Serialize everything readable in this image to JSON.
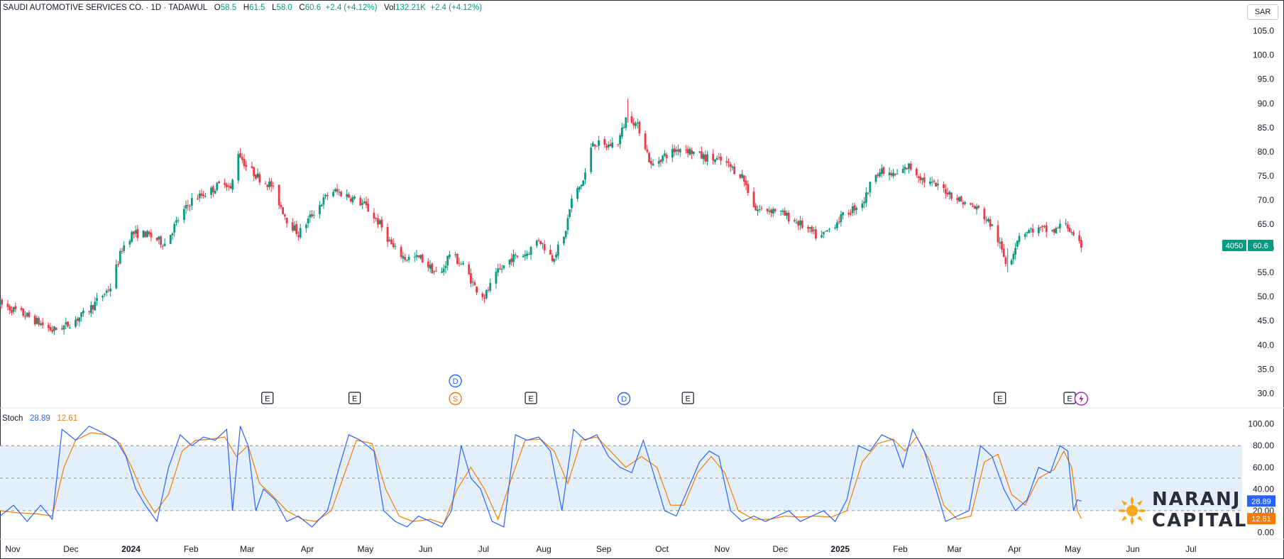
{
  "header": {
    "symbol": "SAUDI AUTOMOTIVE SERVICES CO. · 1D · TADAWUL",
    "o_label": "O",
    "o_value": "58.5",
    "h_label": "H",
    "h_value": "61.5",
    "l_label": "L",
    "l_value": "58.0",
    "c_label": "C",
    "c_value": "60.6",
    "change": "+2.4 (+4.12%)",
    "vol_label": "Vol",
    "vol_value": "132.21K",
    "vol_change": "+2.4 (+4.12%)"
  },
  "currency": "SAR",
  "price_tag": {
    "ticker": "4050",
    "price": "60.6"
  },
  "stoch": {
    "label": "Stoch",
    "k_value": "28.89",
    "d_value": "12.61"
  },
  "logo": {
    "line1": "NARANJ",
    "line2": "CAPITAL"
  },
  "colors": {
    "up": "#089981",
    "down": "#f23645",
    "k": "#2962ff",
    "d": "#f57c00",
    "band": "#e3f0fb"
  },
  "events": [
    {
      "type": "E",
      "date": "2024-03-18"
    },
    {
      "type": "E",
      "date": "2024-05-02"
    },
    {
      "type": "D",
      "date": "2024-06-23"
    },
    {
      "type": "S",
      "date": "2024-06-23"
    },
    {
      "type": "E",
      "date": "2024-08-01"
    },
    {
      "type": "D",
      "date": "2024-09-18"
    },
    {
      "type": "E",
      "date": "2024-10-21"
    },
    {
      "type": "E",
      "date": "2025-03-31"
    },
    {
      "type": "E",
      "date": "2025-05-06"
    },
    {
      "type": "flash",
      "date": "2025-05-12"
    }
  ],
  "chart_data": {
    "type": "candlestick",
    "x_axis": {
      "tick_labels": [
        "Nov",
        "Dec",
        "2024",
        "Feb",
        "Mar",
        "Apr",
        "May",
        "Jun",
        "Jul",
        "Aug",
        "Sep",
        "Oct",
        "Nov",
        "Dec",
        "2025",
        "Feb",
        "Mar",
        "Apr",
        "May",
        "Jun",
        "Jul"
      ],
      "range": [
        "2023-11-01",
        "2025-08-03"
      ]
    },
    "price_axis": {
      "ticks": [
        "105.0",
        "100.0",
        "95.0",
        "90.0",
        "85.0",
        "80.0",
        "75.0",
        "70.0",
        "65.0",
        "60.0",
        "55.0",
        "50.0",
        "45.0",
        "40.0",
        "35.0",
        "30.0"
      ],
      "range": [
        28,
        107
      ],
      "scale": "linear"
    },
    "price_series": [
      [
        "2023-11-01",
        48.5
      ],
      [
        "2023-11-15",
        46
      ],
      [
        "2023-11-28",
        43
      ],
      [
        "2023-12-05",
        44
      ],
      [
        "2023-12-15",
        46.5
      ],
      [
        "2023-12-28",
        52
      ],
      [
        "2024-01-03",
        60
      ],
      [
        "2024-01-08",
        63
      ],
      [
        "2024-01-15",
        63
      ],
      [
        "2024-01-25",
        61
      ],
      [
        "2024-02-01",
        66
      ],
      [
        "2024-02-08",
        70
      ],
      [
        "2024-02-18",
        72
      ],
      [
        "2024-02-25",
        74
      ],
      [
        "2024-02-28",
        72
      ],
      [
        "2024-03-03",
        80
      ],
      [
        "2024-03-07",
        77
      ],
      [
        "2024-03-14",
        74.5
      ],
      [
        "2024-03-20",
        73
      ],
      [
        "2024-03-28",
        66
      ],
      [
        "2024-04-03",
        63
      ],
      [
        "2024-04-10",
        67
      ],
      [
        "2024-04-20",
        72
      ],
      [
        "2024-04-28",
        71
      ],
      [
        "2024-05-07",
        69
      ],
      [
        "2024-05-15",
        65
      ],
      [
        "2024-05-22",
        60
      ],
      [
        "2024-05-28",
        58
      ],
      [
        "2024-06-05",
        58
      ],
      [
        "2024-06-15",
        54
      ],
      [
        "2024-06-20",
        59
      ],
      [
        "2024-06-28",
        56
      ],
      [
        "2024-07-03",
        52
      ],
      [
        "2024-07-08",
        50
      ],
      [
        "2024-07-15",
        55
      ],
      [
        "2024-07-22",
        58
      ],
      [
        "2024-07-30",
        59
      ],
      [
        "2024-08-05",
        62
      ],
      [
        "2024-08-12",
        58
      ],
      [
        "2024-08-18",
        62
      ],
      [
        "2024-08-22",
        70
      ],
      [
        "2024-08-28",
        74
      ],
      [
        "2024-09-02",
        82
      ],
      [
        "2024-09-08",
        81
      ],
      [
        "2024-09-15",
        82
      ],
      [
        "2024-09-20",
        88
      ],
      [
        "2024-09-27",
        84
      ],
      [
        "2024-10-02",
        77
      ],
      [
        "2024-10-08",
        79
      ],
      [
        "2024-10-18",
        81
      ],
      [
        "2024-10-28",
        79
      ],
      [
        "2024-11-08",
        78
      ],
      [
        "2024-11-18",
        75
      ],
      [
        "2024-11-25",
        68
      ],
      [
        "2024-12-05",
        68
      ],
      [
        "2024-12-18",
        65
      ],
      [
        "2024-12-28",
        62
      ],
      [
        "2025-01-07",
        66
      ],
      [
        "2025-01-20",
        70
      ],
      [
        "2025-01-26",
        76
      ],
      [
        "2025-02-05",
        75
      ],
      [
        "2025-02-12",
        77
      ],
      [
        "2025-02-20",
        74
      ],
      [
        "2025-03-03",
        72
      ],
      [
        "2025-03-12",
        69.5
      ],
      [
        "2025-03-20",
        68
      ],
      [
        "2025-03-28",
        64
      ],
      [
        "2025-04-04",
        56
      ],
      [
        "2025-04-10",
        63
      ],
      [
        "2025-04-18",
        64
      ],
      [
        "2025-04-28",
        63.5
      ],
      [
        "2025-05-04",
        65.5
      ],
      [
        "2025-05-09",
        61
      ],
      [
        "2025-05-12",
        60.6
      ]
    ],
    "highlights": {
      "high": 91,
      "low": 42.5,
      "last_close": 60.6
    },
    "stochastic": {
      "axis_ticks": [
        "100.00",
        "80.00",
        "60.00",
        "40.00",
        "20.00",
        "0.00"
      ],
      "range": [
        -3,
        105
      ],
      "levels": [
        80,
        50,
        20
      ],
      "k_last": 28.89,
      "d_last": 12.61,
      "k_series": [
        [
          "2023-11-01",
          15
        ],
        [
          "2023-11-08",
          25
        ],
        [
          "2023-11-15",
          10
        ],
        [
          "2023-11-22",
          25
        ],
        [
          "2023-11-28",
          12
        ],
        [
          "2023-12-03",
          95
        ],
        [
          "2023-12-10",
          85
        ],
        [
          "2023-12-17",
          98
        ],
        [
          "2023-12-24",
          92
        ],
        [
          "2023-12-31",
          85
        ],
        [
          "2024-01-05",
          70
        ],
        [
          "2024-01-10",
          40
        ],
        [
          "2024-01-15",
          25
        ],
        [
          "2024-01-21",
          10
        ],
        [
          "2024-01-27",
          60
        ],
        [
          "2024-02-02",
          90
        ],
        [
          "2024-02-08",
          80
        ],
        [
          "2024-02-14",
          88
        ],
        [
          "2024-02-20",
          85
        ],
        [
          "2024-02-26",
          95
        ],
        [
          "2024-02-29",
          20
        ],
        [
          "2024-03-04",
          98
        ],
        [
          "2024-03-08",
          80
        ],
        [
          "2024-03-12",
          20
        ],
        [
          "2024-03-16",
          40
        ],
        [
          "2024-03-22",
          30
        ],
        [
          "2024-03-28",
          10
        ],
        [
          "2024-04-03",
          15
        ],
        [
          "2024-04-10",
          5
        ],
        [
          "2024-04-18",
          20
        ],
        [
          "2024-04-24",
          60
        ],
        [
          "2024-04-29",
          90
        ],
        [
          "2024-05-05",
          85
        ],
        [
          "2024-05-12",
          75
        ],
        [
          "2024-05-17",
          20
        ],
        [
          "2024-05-23",
          10
        ],
        [
          "2024-05-29",
          5
        ],
        [
          "2024-06-04",
          15
        ],
        [
          "2024-06-10",
          10
        ],
        [
          "2024-06-16",
          5
        ],
        [
          "2024-06-21",
          20
        ],
        [
          "2024-06-26",
          80
        ],
        [
          "2024-07-01",
          50
        ],
        [
          "2024-07-06",
          40
        ],
        [
          "2024-07-12",
          10
        ],
        [
          "2024-07-18",
          5
        ],
        [
          "2024-07-24",
          90
        ],
        [
          "2024-07-30",
          85
        ],
        [
          "2024-08-05",
          88
        ],
        [
          "2024-08-11",
          75
        ],
        [
          "2024-08-17",
          20
        ],
        [
          "2024-08-23",
          95
        ],
        [
          "2024-08-29",
          85
        ],
        [
          "2024-09-04",
          90
        ],
        [
          "2024-09-10",
          70
        ],
        [
          "2024-09-16",
          60
        ],
        [
          "2024-09-22",
          55
        ],
        [
          "2024-09-28",
          85
        ],
        [
          "2024-10-04",
          50
        ],
        [
          "2024-10-09",
          20
        ],
        [
          "2024-10-15",
          15
        ],
        [
          "2024-10-21",
          40
        ],
        [
          "2024-10-27",
          65
        ],
        [
          "2024-11-01",
          75
        ],
        [
          "2024-11-06",
          70
        ],
        [
          "2024-11-12",
          20
        ],
        [
          "2024-11-18",
          10
        ],
        [
          "2024-11-24",
          15
        ],
        [
          "2024-11-30",
          10
        ],
        [
          "2024-12-06",
          15
        ],
        [
          "2024-12-12",
          20
        ],
        [
          "2024-12-18",
          10
        ],
        [
          "2024-12-24",
          15
        ],
        [
          "2024-12-30",
          20
        ],
        [
          "2025-01-05",
          10
        ],
        [
          "2025-01-11",
          30
        ],
        [
          "2025-01-17",
          80
        ],
        [
          "2025-01-23",
          75
        ],
        [
          "2025-01-29",
          90
        ],
        [
          "2025-02-04",
          85
        ],
        [
          "2025-02-09",
          60
        ],
        [
          "2025-02-14",
          95
        ],
        [
          "2025-02-20",
          75
        ],
        [
          "2025-02-26",
          40
        ],
        [
          "2025-03-03",
          10
        ],
        [
          "2025-03-09",
          15
        ],
        [
          "2025-03-15",
          20
        ],
        [
          "2025-03-21",
          80
        ],
        [
          "2025-03-27",
          70
        ],
        [
          "2025-04-02",
          40
        ],
        [
          "2025-04-08",
          20
        ],
        [
          "2025-04-14",
          30
        ],
        [
          "2025-04-20",
          60
        ],
        [
          "2025-04-26",
          55
        ],
        [
          "2025-05-01",
          80
        ],
        [
          "2025-05-05",
          75
        ],
        [
          "2025-05-08",
          20
        ],
        [
          "2025-05-10",
          30
        ],
        [
          "2025-05-12",
          28.89
        ]
      ],
      "d_series": [
        [
          "2023-11-01",
          20
        ],
        [
          "2023-11-10",
          18
        ],
        [
          "2023-11-20",
          17
        ],
        [
          "2023-11-28",
          15
        ],
        [
          "2023-12-04",
          60
        ],
        [
          "2023-12-10",
          85
        ],
        [
          "2023-12-18",
          92
        ],
        [
          "2023-12-26",
          90
        ],
        [
          "2024-01-02",
          82
        ],
        [
          "2024-01-08",
          60
        ],
        [
          "2024-01-14",
          35
        ],
        [
          "2024-01-20",
          18
        ],
        [
          "2024-01-27",
          35
        ],
        [
          "2024-02-03",
          75
        ],
        [
          "2024-02-10",
          85
        ],
        [
          "2024-02-18",
          86
        ],
        [
          "2024-02-25",
          88
        ],
        [
          "2024-03-02",
          70
        ],
        [
          "2024-03-08",
          80
        ],
        [
          "2024-03-14",
          45
        ],
        [
          "2024-03-20",
          35
        ],
        [
          "2024-03-28",
          20
        ],
        [
          "2024-04-05",
          12
        ],
        [
          "2024-04-12",
          10
        ],
        [
          "2024-04-20",
          20
        ],
        [
          "2024-04-26",
          50
        ],
        [
          "2024-05-03",
          85
        ],
        [
          "2024-05-11",
          82
        ],
        [
          "2024-05-18",
          40
        ],
        [
          "2024-05-25",
          15
        ],
        [
          "2024-06-01",
          10
        ],
        [
          "2024-06-10",
          12
        ],
        [
          "2024-06-17",
          8
        ],
        [
          "2024-06-24",
          40
        ],
        [
          "2024-07-01",
          60
        ],
        [
          "2024-07-08",
          40
        ],
        [
          "2024-07-15",
          12
        ],
        [
          "2024-07-22",
          50
        ],
        [
          "2024-07-29",
          85
        ],
        [
          "2024-08-06",
          86
        ],
        [
          "2024-08-13",
          75
        ],
        [
          "2024-08-20",
          45
        ],
        [
          "2024-08-27",
          85
        ],
        [
          "2024-09-04",
          88
        ],
        [
          "2024-09-11",
          75
        ],
        [
          "2024-09-19",
          60
        ],
        [
          "2024-09-27",
          70
        ],
        [
          "2024-10-05",
          60
        ],
        [
          "2024-10-12",
          25
        ],
        [
          "2024-10-19",
          25
        ],
        [
          "2024-10-26",
          55
        ],
        [
          "2024-11-02",
          70
        ],
        [
          "2024-11-09",
          55
        ],
        [
          "2024-11-16",
          20
        ],
        [
          "2024-11-24",
          12
        ],
        [
          "2024-12-02",
          12
        ],
        [
          "2024-12-10",
          15
        ],
        [
          "2024-12-18",
          14
        ],
        [
          "2024-12-26",
          15
        ],
        [
          "2025-01-03",
          14
        ],
        [
          "2025-01-11",
          20
        ],
        [
          "2025-01-19",
          65
        ],
        [
          "2025-01-27",
          82
        ],
        [
          "2025-02-04",
          86
        ],
        [
          "2025-02-10",
          75
        ],
        [
          "2025-02-16",
          88
        ],
        [
          "2025-02-23",
          65
        ],
        [
          "2025-03-02",
          25
        ],
        [
          "2025-03-09",
          12
        ],
        [
          "2025-03-16",
          15
        ],
        [
          "2025-03-23",
          65
        ],
        [
          "2025-03-30",
          72
        ],
        [
          "2025-04-06",
          35
        ],
        [
          "2025-04-13",
          25
        ],
        [
          "2025-04-20",
          50
        ],
        [
          "2025-04-28",
          58
        ],
        [
          "2025-05-03",
          75
        ],
        [
          "2025-05-07",
          60
        ],
        [
          "2025-05-10",
          20
        ],
        [
          "2025-05-12",
          12.61
        ]
      ]
    }
  }
}
